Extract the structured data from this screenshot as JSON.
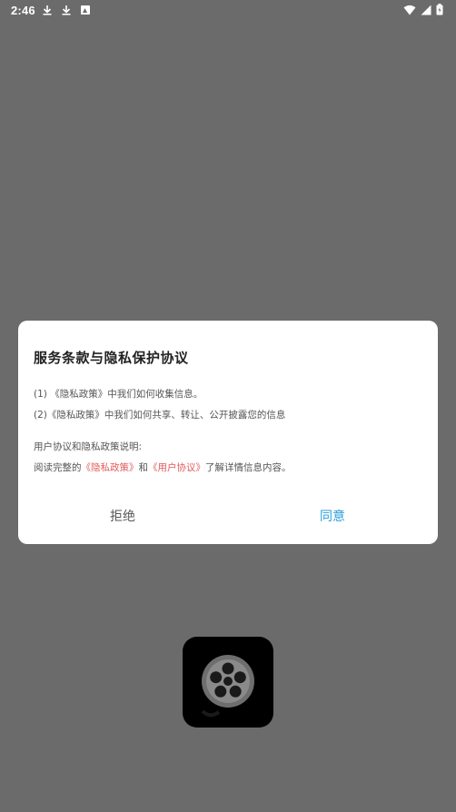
{
  "status_bar": {
    "time": "2:46",
    "left_icons": [
      "download-icon",
      "download-icon",
      "photo-icon"
    ],
    "right_icons": [
      "wifi-icon",
      "signal-icon",
      "battery-icon"
    ]
  },
  "dialog": {
    "title": "服务条款与隐私保护协议",
    "lines": [
      "(1) 《隐私政策》中我们如何收集信息。",
      "(2)《隐私政策》中我们如何共享、转让、公开披露您的信息",
      "用户协议和隐私政策说明:"
    ],
    "read_line": {
      "prefix": "阅读完整的",
      "privacy_link": "《隐私政策》",
      "conjunction": "和",
      "user_link": "《用户协议》",
      "suffix": "了解详情信息内容。"
    },
    "buttons": {
      "refuse": "拒绝",
      "agree": "同意"
    },
    "colors": {
      "link": "#e35b5b",
      "agree": "#2a9dd8"
    }
  },
  "app_icon": {
    "icon": "film-reel-icon"
  },
  "colors": {
    "scrim": "#6b6b6b"
  }
}
